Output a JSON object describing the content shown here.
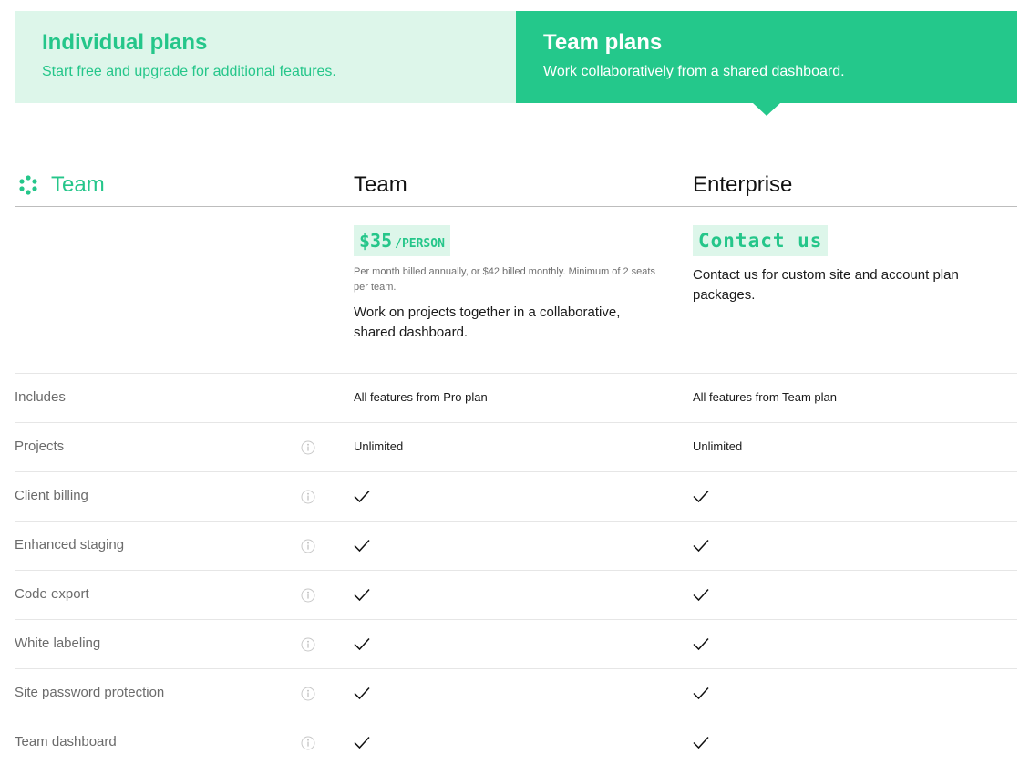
{
  "tabs": [
    {
      "title": "Individual plans",
      "subtitle": "Start free and upgrade for additional features."
    },
    {
      "title": "Team plans",
      "subtitle": "Work collaboratively from a shared dashboard."
    }
  ],
  "active_tab": "Team plans",
  "colors": {
    "accent": "#24c88b",
    "accent_light": "#ddf6ea",
    "muted_text": "#6b6b6b"
  },
  "header": {
    "brand_label": "Team",
    "columns": [
      "Team",
      "Enterprise"
    ]
  },
  "pricing": {
    "team": {
      "price": "$35",
      "unit": "/PERSON",
      "fine_print": "Per month billed annually, or $42 billed monthly. Minimum of 2 seats per team.",
      "description": "Work on projects together in a collaborative, shared dashboard."
    },
    "enterprise": {
      "cta": "Contact us",
      "description": "Contact us for custom site and account plan packages."
    }
  },
  "features": [
    {
      "label": "Includes",
      "info": false,
      "team": "All features from Pro plan",
      "enterprise": "All features from Team plan"
    },
    {
      "label": "Projects",
      "info": true,
      "team": "Unlimited",
      "enterprise": "Unlimited"
    },
    {
      "label": "Client billing",
      "info": true,
      "team": true,
      "enterprise": true
    },
    {
      "label": "Enhanced staging",
      "info": true,
      "team": true,
      "enterprise": true
    },
    {
      "label": "Code export",
      "info": true,
      "team": true,
      "enterprise": true
    },
    {
      "label": "White labeling",
      "info": true,
      "team": true,
      "enterprise": true
    },
    {
      "label": "Site password protection",
      "info": true,
      "team": true,
      "enterprise": true
    },
    {
      "label": "Team dashboard",
      "info": true,
      "team": true,
      "enterprise": true
    }
  ]
}
